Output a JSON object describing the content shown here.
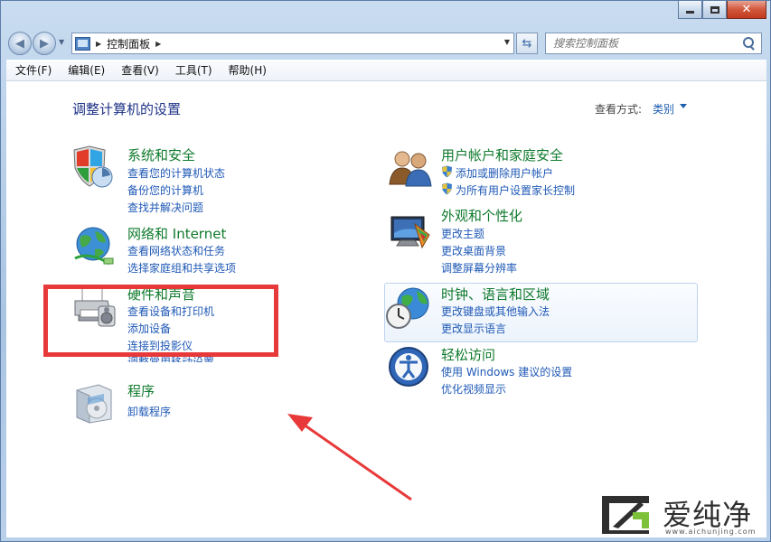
{
  "window": {
    "caption_buttons": [
      "minimize",
      "maximize",
      "close"
    ]
  },
  "address_bar": {
    "breadcrumb": "控制面板",
    "search_placeholder": "搜索控制面板"
  },
  "menu": [
    "文件(F)",
    "编辑(E)",
    "查看(V)",
    "工具(T)",
    "帮助(H)"
  ],
  "content": {
    "title": "调整计算机的设置",
    "view_by_label": "查看方式:",
    "view_by_value": "类别"
  },
  "categories": {
    "system_security": {
      "title": "系统和安全",
      "links": [
        "查看您的计算机状态",
        "备份您的计算机",
        "查找并解决问题"
      ]
    },
    "network": {
      "title": "网络和 Internet",
      "links": [
        "查看网络状态和任务",
        "选择家庭组和共享选项"
      ]
    },
    "hardware": {
      "title": "硬件和声音",
      "links": [
        "查看设备和打印机",
        "添加设备",
        "连接到投影仪",
        "调整常用移动设置"
      ]
    },
    "programs": {
      "title": "程序",
      "links": [
        "卸载程序"
      ]
    },
    "user_accounts": {
      "title": "用户帐户和家庭安全",
      "links": [
        "添加或删除用户帐户",
        "为所有用户设置家长控制"
      ]
    },
    "appearance": {
      "title": "外观和个性化",
      "links": [
        "更改主题",
        "更改桌面背景",
        "调整屏幕分辨率"
      ]
    },
    "clock": {
      "title": "时钟、语言和区域",
      "links": [
        "更改键盘或其他输入法",
        "更改显示语言"
      ]
    },
    "ease": {
      "title": "轻松访问",
      "links": [
        "使用 Windows 建议的设置",
        "优化视频显示"
      ]
    }
  },
  "watermark": {
    "text": "爱纯净",
    "url": "www.aichunjing.com"
  },
  "colors": {
    "category_title": "#0f7a2c",
    "link": "#1f59b6",
    "heading": "#1e3287",
    "highlight_border": "#e8393a"
  }
}
